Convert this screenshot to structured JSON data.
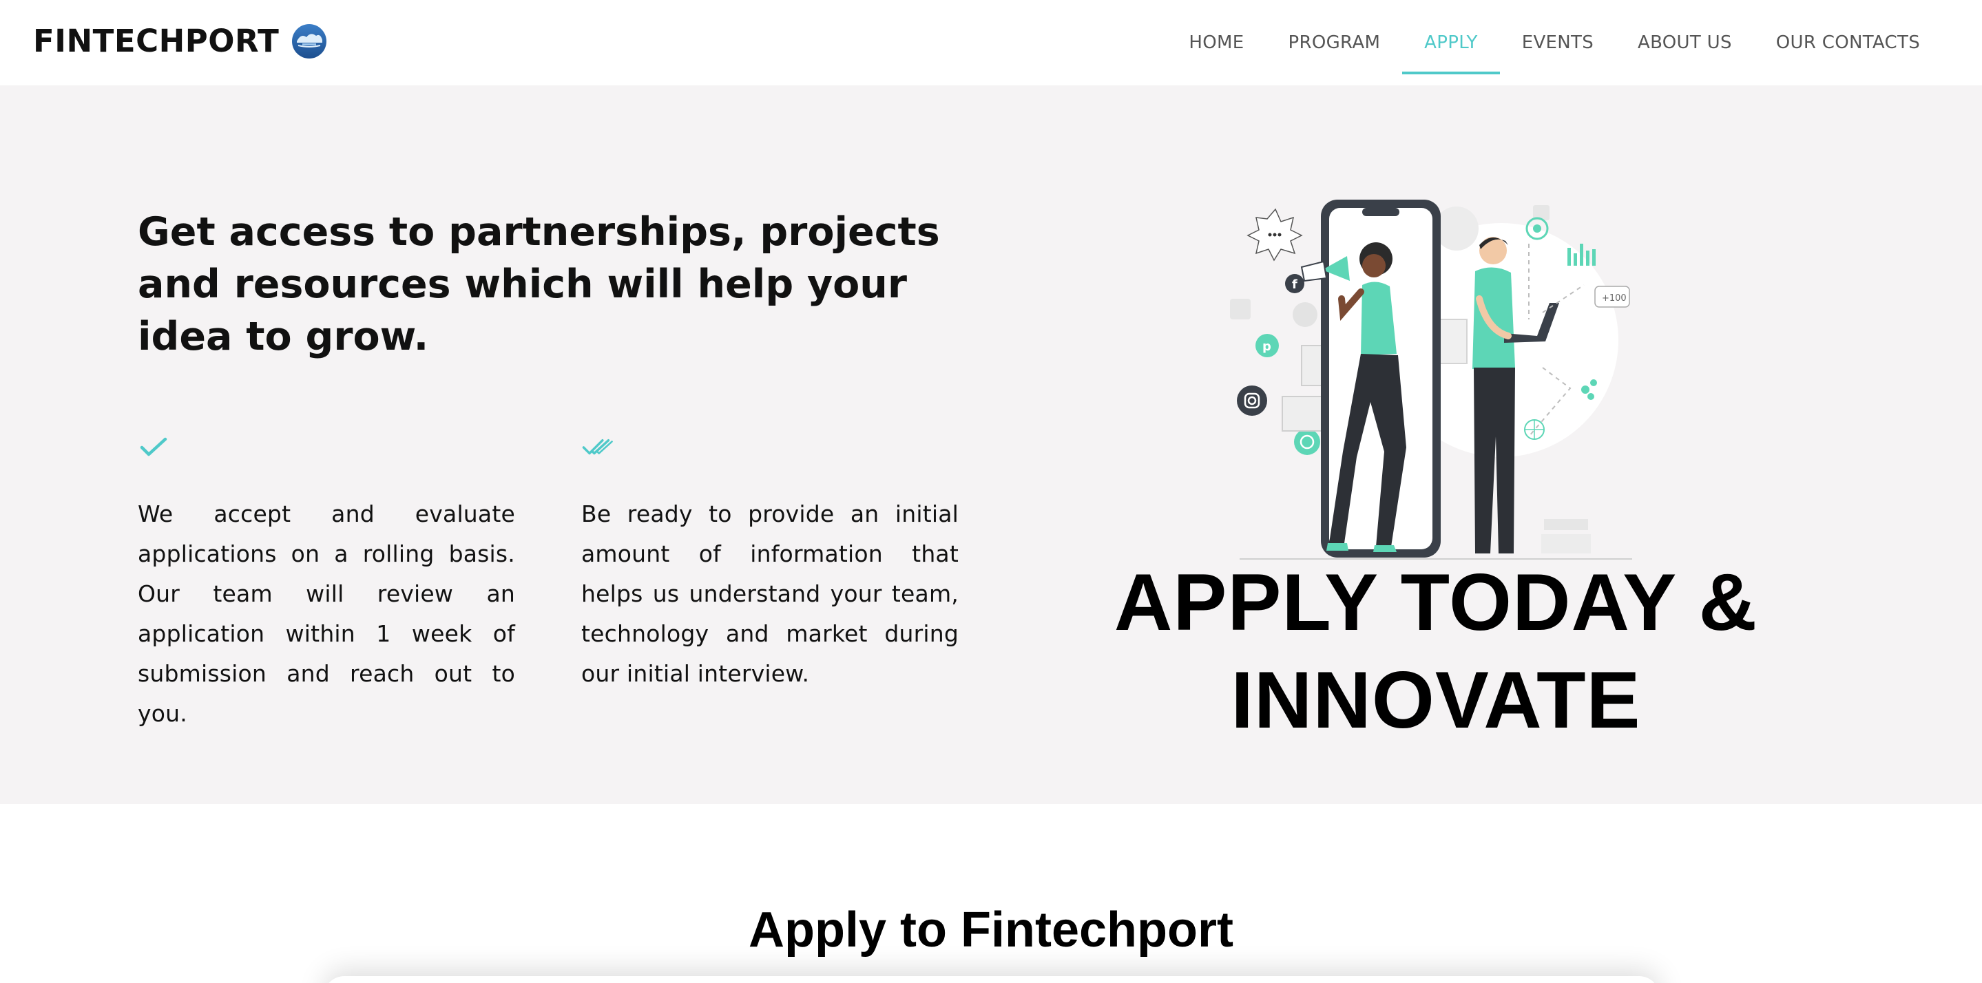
{
  "brand": {
    "name": "FINTECHPORT",
    "logo_icon": "fintechport-logo-icon"
  },
  "nav": {
    "items": [
      {
        "label": "HOME",
        "active": false
      },
      {
        "label": "PROGRAM",
        "active": false
      },
      {
        "label": "APPLY",
        "active": true
      },
      {
        "label": "EVENTS",
        "active": false
      },
      {
        "label": "ABOUT US",
        "active": false
      },
      {
        "label": "OUR CONTACTS",
        "active": false
      }
    ]
  },
  "hero": {
    "headline": "Get access to partnerships, projects and resources which will help your idea to grow.",
    "features": [
      {
        "icon": "check-icon",
        "text": "We accept and evaluate applications on a rolling basis. Our team will review an application within 1 week of submission and reach out to you."
      },
      {
        "icon": "double-check-icon",
        "text": "Be ready to provide an initial amount of information that helps us understand your team, technology and market during our initial interview."
      }
    ],
    "cta_title": "APPLY TODAY & INNOVATE",
    "illustration": "social-media-marketing-illustration"
  },
  "form_section": {
    "title": "Apply to Fintechport"
  },
  "colors": {
    "accent": "#4fc9c9",
    "hero_bg": "#f5f3f4",
    "nav_text": "#555555",
    "text": "#111111"
  }
}
